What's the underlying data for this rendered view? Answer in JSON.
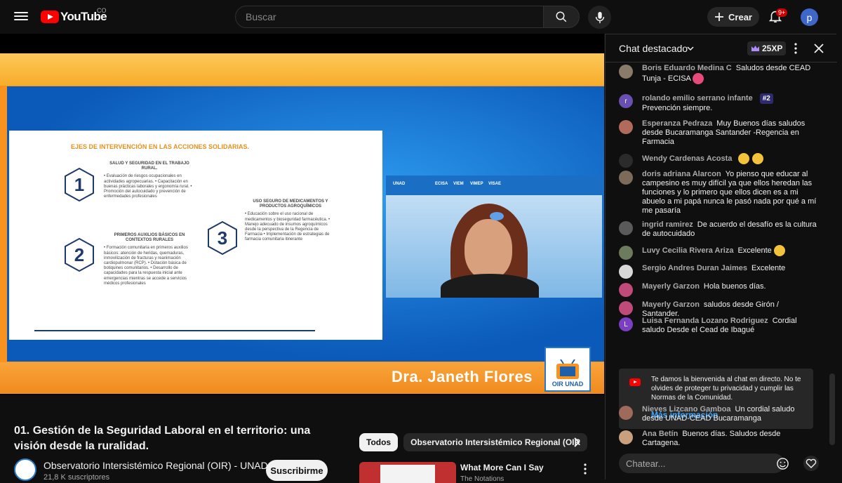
{
  "header": {
    "logo_text": "YouTube",
    "logo_region": "CO",
    "search_placeholder": "Buscar",
    "create_label": "Crear",
    "notifications_badge": "9+",
    "avatar_letter": "p"
  },
  "player": {
    "slide": {
      "title": "EJES DE INTERVENCIÓN EN LAS ACCIONES SOLIDARIAS.",
      "block1_head": "SALUD Y SEGURIDAD EN EL TRABAJO RURAL.",
      "block1_text": "• Evaluación de riesgos ocupacionales en actividades agropecuarias. • Capacitación en buenas prácticas laborales y ergonomía rural. • Promoción del autocuidado y prevención de enfermedades profesionales",
      "block2_head": "PRIMEROS AUXILIOS BÁSICOS EN CONTEXTOS RURALES",
      "block2_text": "• Formación comunitaria en primeros auxilios básicos: atención de heridas, quemaduras, inmovilización de fracturas y reanimación cardiopulmonar (RCP). • Dotación básica de botiquines comunitarios. • Desarrollo de capacidades para la respuesta inicial ante emergencias mientras se accede a servicios médicos profesionales",
      "block3_head": "USO SEGURO DE MEDICAMENTOS Y PRODUCTOS AGROQUÍMICOS",
      "block3_text": "• Educación sobre el uso racional de medicamentos y bioseguridad farmacéutica. • Manejo adecuado de insumos agroquímicos desde la perspectiva de la Regencia de Farmacia • Implementación de estrategias de farmacia comunitaria itinerante",
      "hex1": "1",
      "hex2": "2",
      "hex3": "3"
    },
    "cam_band": [
      "UNAD",
      "ECISA",
      "VIEM",
      "VIMEP",
      "VISAE"
    ],
    "speaker_name": "Dra. Janeth Flores",
    "oir_logo_text": "OIR UNAD"
  },
  "video": {
    "title": "01. Gestión de la Seguridad Laboral en el territorio: una visión desde la ruralidad.",
    "channel_name": "Observatorio Intersistémico Regional (OIR) - UNAD",
    "subscribers": "21,8 K suscriptores",
    "subscribe_label": "Suscribirme"
  },
  "related": {
    "chips": [
      "Todos",
      "Observatorio Intersistémico Regional (OIR"
    ],
    "first_title": "What More Can I Say",
    "first_channel": "The Notations"
  },
  "chat": {
    "title": "Chat destacado",
    "xp": "25XP",
    "input_placeholder": "Chatear...",
    "messages": [
      {
        "author": "Boris Eduardo Medina C",
        "text": "Saludos desde CEAD Tunja - ECISA",
        "avatar": "",
        "avatar_color": "#8a7a6a"
      },
      {
        "author": "rolando emilio serrano infante",
        "text": "Prevención siempre.",
        "badge": "#2",
        "avatar": "r",
        "avatar_color": "#6a4fb3"
      },
      {
        "author": "Esperanza Pedraza",
        "text": "Muy Buenos días saludos desde Bucaramanga Santander -Regencia en Farmacia",
        "avatar": "",
        "avatar_color": "#b06b5a"
      },
      {
        "author": "Wendy Cardenas Acosta",
        "text": "",
        "avatar": "",
        "avatar_color": "#2b2b2b"
      },
      {
        "author": "doris adriana Alarcon",
        "text": "Yo pienso que educar al campesino es muy difícil ya que ellos heredan las funciones y lo primero que ellos dicen es a mi abuelo a mi papá nunca le pasó nada por qué a mí me pasaría",
        "avatar": "",
        "avatar_color": "#7c6b5b"
      },
      {
        "author": "ingrid ramirez",
        "text": "De acuerdo el desafío es la cultura de autocuidado",
        "avatar": "",
        "avatar_color": "#5a5a5a"
      },
      {
        "author": "Luvy Cecilia Rivera Ariza",
        "text": "Excelente",
        "avatar": "",
        "avatar_color": "#6b7b5b"
      },
      {
        "author": "Sergio Andres Duran Jaimes",
        "text": "Excelente",
        "avatar": "",
        "avatar_color": "#d8d8d8"
      },
      {
        "author": "Mayerly Garzon",
        "text": "Hola buenos días.",
        "avatar": "",
        "avatar_color": "#c04a7a"
      },
      {
        "author": "Mayerly Garzon",
        "text": "saludos desde Girón / Santander.",
        "avatar": "",
        "avatar_color": "#c04a7a"
      },
      {
        "author": "Luisa Fernanda Lozano Rodriguez",
        "text": "Cordial saludo Desde el Cead de Ibagué",
        "avatar": "L",
        "avatar_color": "#7b3fc4"
      },
      {
        "author": "Nieves Lizcano Gamboa",
        "text": "Un cordial saludo desde UNAD-CEAD Bucaramanga",
        "avatar": "",
        "avatar_color": "#a06a5a"
      },
      {
        "author": "Ana Betín",
        "text": "Buenos días. Saludos desde Cartagena.",
        "avatar": "",
        "avatar_color": "#c8a080"
      }
    ],
    "notice_text": "Te damos la bienvenida al chat en directo. No te olvides de proteger tu privacidad y cumplir las Normas de la Comunidad.",
    "notice_link": "Más información"
  }
}
